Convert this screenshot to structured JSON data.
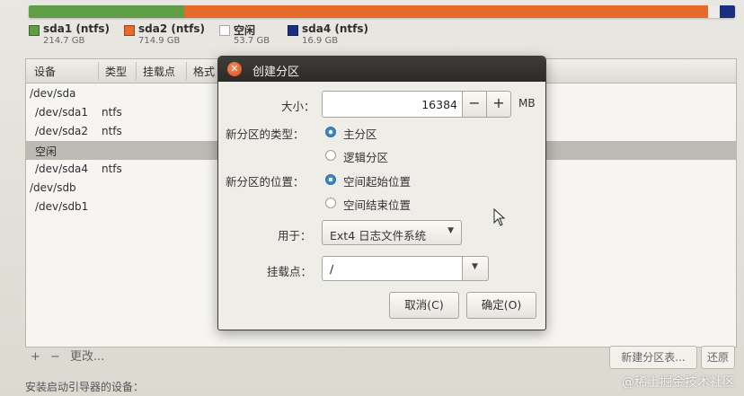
{
  "partition_bar": {
    "segments": [
      {
        "name": "sda1",
        "color": "#5f9d46",
        "fraction": 0.22
      },
      {
        "name": "sda2",
        "color": "#e56b2c",
        "fraction": 0.742
      },
      {
        "name": "free",
        "color": "#ecebe6",
        "fraction": 0.017
      },
      {
        "name": "sda4",
        "color": "#1a2e82",
        "fraction": 0.021
      }
    ]
  },
  "legend": [
    {
      "name": "sda1 (ntfs)",
      "size": "214.7 GB",
      "color": "#5f9d46"
    },
    {
      "name": "sda2 (ntfs)",
      "size": "714.9 GB",
      "color": "#e56b2c"
    },
    {
      "name": "空闲",
      "size": "53.7 GB",
      "color": "#ffffff"
    },
    {
      "name": "sda4 (ntfs)",
      "size": "16.9 GB",
      "color": "#1a2e82"
    }
  ],
  "table": {
    "headers": [
      "设备",
      "类型",
      "挂载点",
      "格式"
    ],
    "rows": [
      {
        "device": "/dev/sda",
        "type": ""
      },
      {
        "device": "/dev/sda1",
        "type": "ntfs"
      },
      {
        "device": "/dev/sda2",
        "type": "ntfs"
      },
      {
        "device": "空闲",
        "type": ""
      },
      {
        "device": "/dev/sda4",
        "type": "ntfs"
      },
      {
        "device": "/dev/sdb",
        "type": ""
      },
      {
        "device": "/dev/sdb1",
        "type": ""
      }
    ]
  },
  "bottom": {
    "add": "+",
    "remove": "−",
    "change": "更改...",
    "new_table": "新建分区表...",
    "revert": "还原",
    "boot_loader_label": "安装启动引导器的设备："
  },
  "dialog": {
    "title": "创建分区",
    "size_label": "大小：",
    "size_value": "16384",
    "minus": "−",
    "plus": "+",
    "unit": "MB",
    "type_label": "新分区的类型：",
    "type_primary": "主分区",
    "type_logical": "逻辑分区",
    "location_label": "新分区的位置：",
    "location_start": "空间起始位置",
    "location_end": "空间结束位置",
    "use_label": "用于：",
    "use_value": "Ext4 日志文件系统",
    "mount_label": "挂载点：",
    "mount_value": "/",
    "cancel": "取消(C)",
    "ok": "确定(O)"
  },
  "watermark": "@稀土掘金技术社区"
}
